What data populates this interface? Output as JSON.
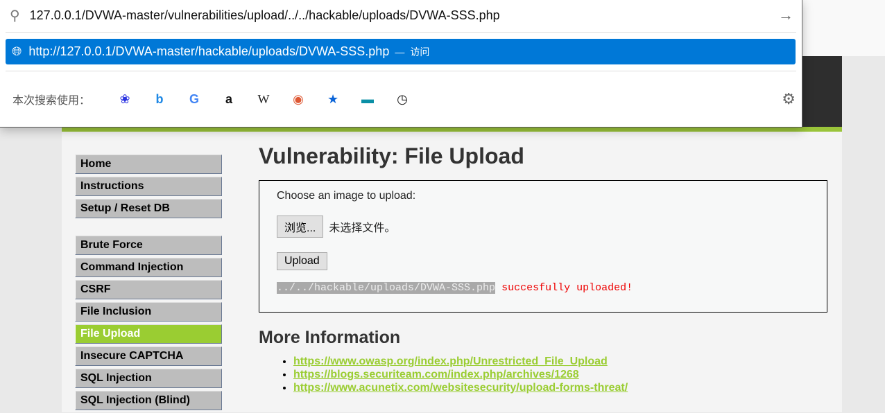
{
  "urlbar": {
    "value": "127.0.0.1/DVWA-master/vulnerabilities/upload/../../hackable/uploads/DVWA-SSS.php",
    "suggestion_url": "http://127.0.0.1/DVWA-master/hackable/uploads/DVWA-SSS.php",
    "suggestion_dash": "—",
    "suggestion_action": "访问",
    "search_with_label": "本次搜索使用：",
    "engines": [
      "baidu",
      "bing",
      "google",
      "amazon",
      "wikipedia",
      "duckduckgo",
      "bookmarks",
      "tabs",
      "history"
    ],
    "accent": "#0078d7"
  },
  "sidebar": {
    "items": [
      "Home",
      "Instructions",
      "Setup / Reset DB",
      "Brute Force",
      "Command Injection",
      "CSRF",
      "File Inclusion",
      "File Upload",
      "Insecure CAPTCHA",
      "SQL Injection",
      "SQL Injection (Blind)"
    ],
    "active": "File Upload",
    "active_color": "#9acd32"
  },
  "main": {
    "title": "Vulnerability: File Upload",
    "choose_label": "Choose an image to upload:",
    "browse_button": "浏览...",
    "no_file": "未选择文件。",
    "upload_button": "Upload",
    "result_path": "../../hackable/uploads/DVWA-SSS.php",
    "result_msg": "succesfully uploaded!",
    "more_info_title": "More Information",
    "links": [
      "https://www.owasp.org/index.php/Unrestricted_File_Upload",
      "https://blogs.securiteam.com/index.php/archives/1268",
      "https://www.acunetix.com/websitesecurity/upload-forms-threat/"
    ]
  }
}
